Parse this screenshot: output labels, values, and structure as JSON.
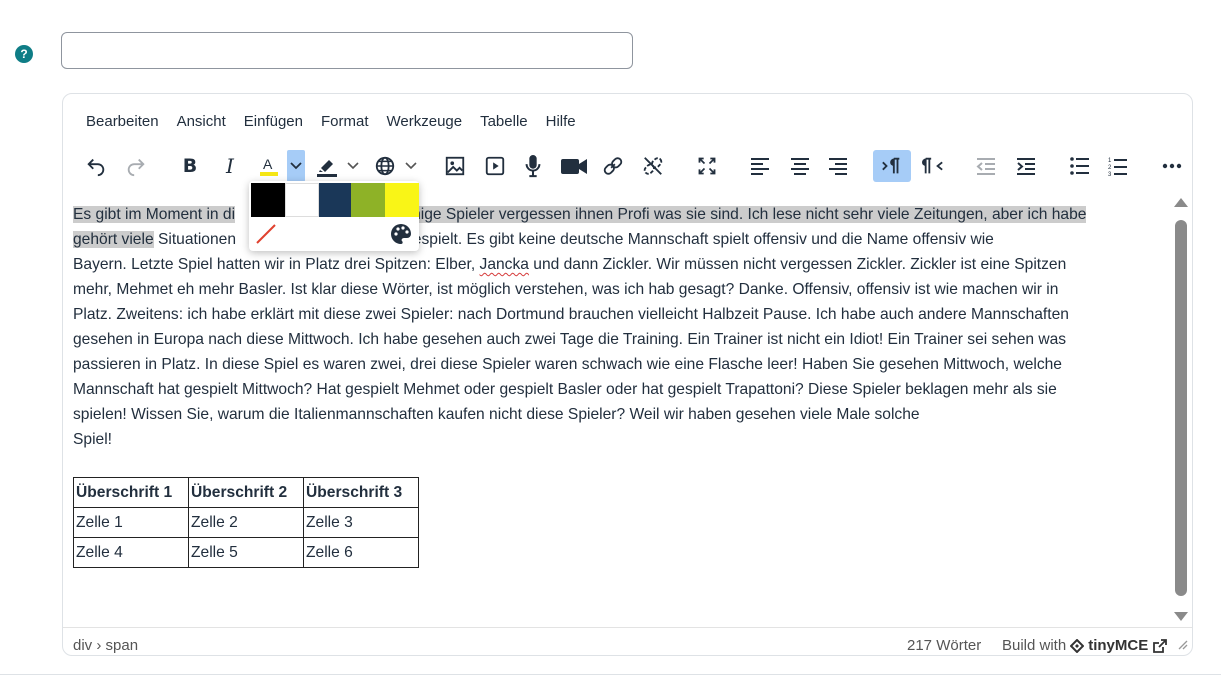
{
  "help": {
    "label": "?"
  },
  "title_input": {
    "value": "",
    "placeholder": ""
  },
  "menubar": [
    "Bearbeiten",
    "Ansicht",
    "Einfügen",
    "Format",
    "Werkzeuge",
    "Tabelle",
    "Hilfe"
  ],
  "toolbar": {
    "icons": [
      "undo-icon",
      "redo-icon",
      "bold-icon",
      "italic-icon",
      "text-color-icon",
      "highlight-icon",
      "language-icon",
      "image-icon",
      "media-icon",
      "microphone-icon",
      "video-icon",
      "link-icon",
      "unlink-icon",
      "fullscreen-icon",
      "align-left-icon",
      "align-center-icon",
      "align-right-icon",
      "ltr-icon",
      "rtl-icon",
      "outdent-icon",
      "indent-icon",
      "bullet-list-icon",
      "numbered-list-icon",
      "more-icon"
    ],
    "text_color_accent": "#f5e614",
    "active_color": "#a6ccf7"
  },
  "palette": {
    "colors": [
      "#000000",
      "#ffffff",
      "#1a3758",
      "#8eb227",
      "#f9f517"
    ]
  },
  "content": {
    "line1_hl_start": "Es gibt im Moment in di",
    "line1_hl_end": "nige Spieler vergessen ihnen Profi was sie sind. Ich lese nicht sehr viele Zeitungen, aber ich habe",
    "line2_hl": "gehört viele",
    "line2_rest_a": " Situationen",
    "line2_rest_b": "ht offensiv gespielt. Es gibt keine deutsche Mannschaft spielt offensiv und die Name offensiv wie",
    "line3_a": "Bayern. Letzte Spiel hatten wir in Platz drei Spitzen: Elber, ",
    "line3_misspelled": "Jancka",
    "line3_b": " und dann Zickler. Wir müssen nicht vergessen Zickler. Zickler ist eine Spitzen",
    "line4": "mehr, Mehmet eh mehr Basler. Ist klar diese Wörter, ist möglich verstehen, was ich hab gesagt? Danke. Offensiv, offensiv ist wie machen wir in",
    "line5": "Platz. Zweitens: ich habe erklärt mit diese zwei Spieler: nach Dortmund brauchen vielleicht Halbzeit Pause. Ich habe auch andere Mannschaften",
    "line6": "gesehen in Europa nach diese Mittwoch. Ich habe gesehen auch zwei Tage die Training. Ein Trainer ist nicht ein Idiot! Ein Trainer sei sehen was",
    "line7": "passieren in Platz. In diese Spiel es waren zwei, drei diese Spieler waren schwach wie eine Flasche leer! Haben Sie gesehen Mittwoch, welche",
    "line8": "Mannschaft hat gespielt Mittwoch? Hat gespielt Mehmet oder gespielt Basler oder hat gespielt Trapattoni? Diese Spieler beklagen mehr als sie",
    "line9": "spielen! Wissen Sie, warum die Italienmannschaften kaufen nicht diese Spieler? Weil wir haben gesehen viele Male solche",
    "line10": "Spiel!"
  },
  "table": {
    "headers": [
      "Überschrift 1",
      "Überschrift 2",
      "Überschrift 3"
    ],
    "rows": [
      [
        "Zelle 1",
        "Zelle 2",
        "Zelle 3"
      ],
      [
        "Zelle 4",
        "Zelle 5",
        "Zelle 6"
      ]
    ]
  },
  "statusbar": {
    "path": "div › span",
    "word_count": "217 Wörter",
    "build_with": "Build with",
    "brand": "tinyMCE"
  }
}
